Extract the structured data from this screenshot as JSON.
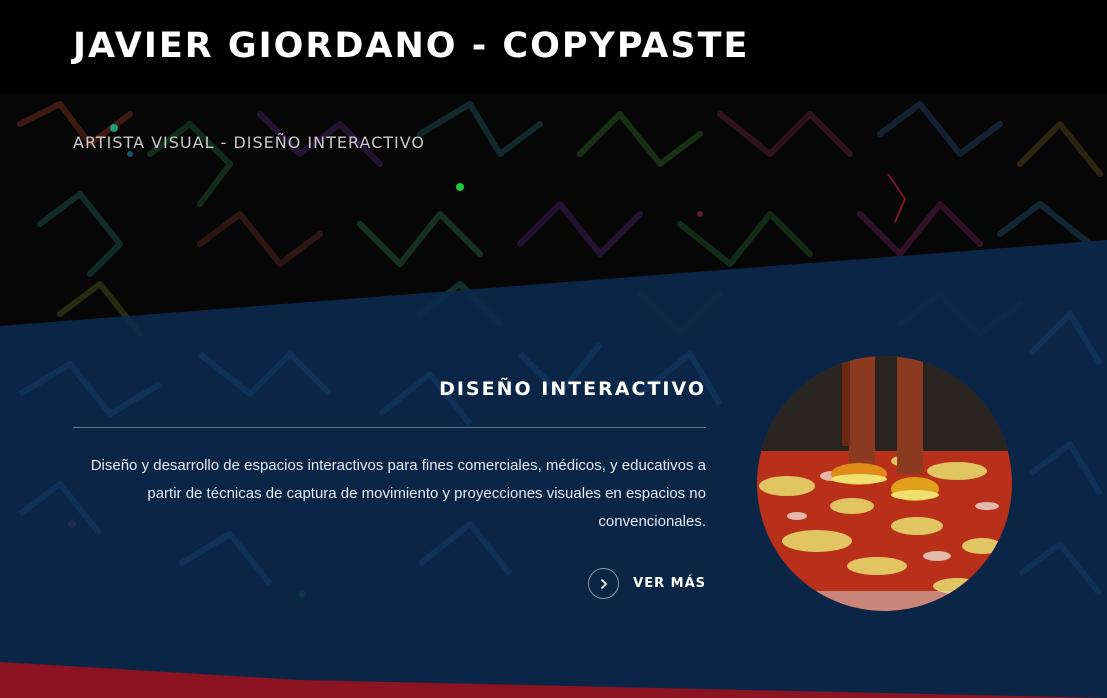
{
  "header": {
    "title": "JAVIER GIORDANO - COPYPASTE"
  },
  "hero": {
    "subtitle": "ARTISTA VISUAL - DISEÑO INTERACTIVO"
  },
  "section": {
    "title": "DISEÑO INTERACTIVO",
    "description": "Diseño y desarrollo de espacios interactivos para fines comerciales, médicos, y educativos a partir de técnicas de captura de movimiento y proyecciones visuales en espacios no convencionales.",
    "cta_label": "VER MÁS",
    "cta_icon": "chevron-right-icon"
  },
  "colors": {
    "header_bg": "#000000",
    "panel_blue": "#0b2a4e",
    "text_white": "#ffffff",
    "accent_red": "#b0141a"
  }
}
